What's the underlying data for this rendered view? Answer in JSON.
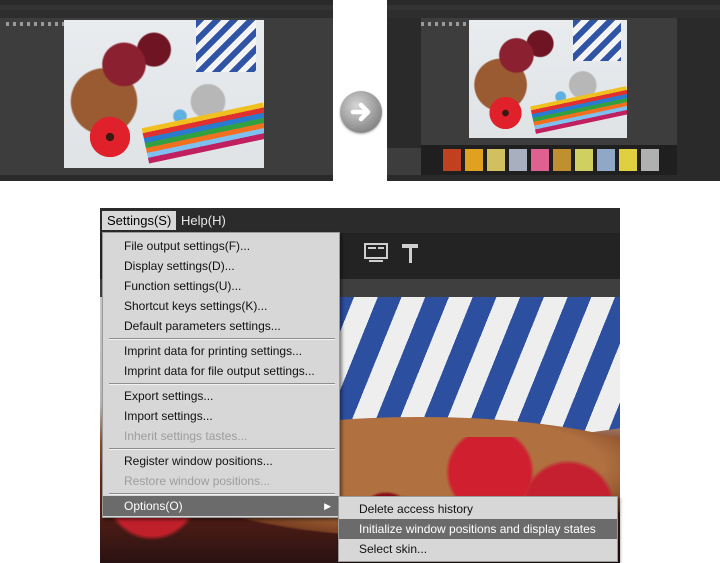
{
  "menubar": {
    "settings_label": "Settings(S)",
    "help_label": "Help(H)"
  },
  "settings_menu": {
    "items": [
      {
        "label": "File output settings(F)...",
        "enabled": true
      },
      {
        "label": "Display settings(D)...",
        "enabled": true
      },
      {
        "label": "Function settings(U)...",
        "enabled": true
      },
      {
        "label": "Shortcut keys settings(K)...",
        "enabled": true
      },
      {
        "label": "Default parameters settings...",
        "enabled": true
      },
      {
        "label": "Imprint data for printing settings...",
        "enabled": true
      },
      {
        "label": "Imprint data for file output settings...",
        "enabled": true
      },
      {
        "label": "Export settings...",
        "enabled": true
      },
      {
        "label": "Import settings...",
        "enabled": true
      },
      {
        "label": "Inherit settings tastes...",
        "enabled": false
      },
      {
        "label": "Register window positions...",
        "enabled": true
      },
      {
        "label": "Restore window positions...",
        "enabled": false
      },
      {
        "label": "Options(O)",
        "enabled": true
      }
    ]
  },
  "options_submenu": {
    "items": [
      {
        "label": "Delete access history"
      },
      {
        "label": "Initialize window positions and display states"
      },
      {
        "label": "Select skin..."
      }
    ]
  },
  "icons": {
    "transition": "arrow-right-icon",
    "toolbar": [
      "monitor-icon",
      "hammer-icon"
    ]
  },
  "colors": {
    "menu_bg": "#d7d7d7",
    "menu_highlight": "#6b6b6b",
    "app_bg": "#2b2b2b"
  }
}
